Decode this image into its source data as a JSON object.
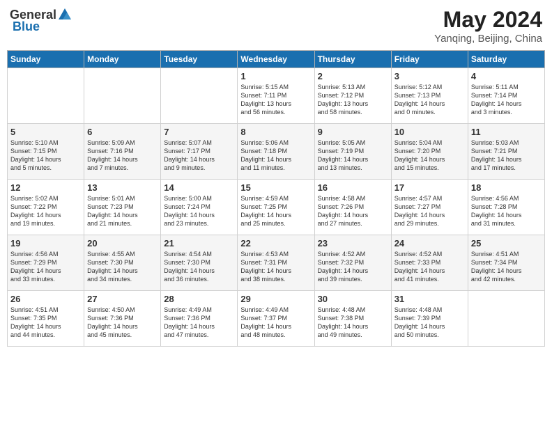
{
  "header": {
    "logo_general": "General",
    "logo_blue": "Blue",
    "month": "May 2024",
    "location": "Yanqing, Beijing, China"
  },
  "days_of_week": [
    "Sunday",
    "Monday",
    "Tuesday",
    "Wednesday",
    "Thursday",
    "Friday",
    "Saturday"
  ],
  "weeks": [
    {
      "days": [
        {
          "num": "",
          "info": ""
        },
        {
          "num": "",
          "info": ""
        },
        {
          "num": "",
          "info": ""
        },
        {
          "num": "1",
          "info": "Sunrise: 5:15 AM\nSunset: 7:11 PM\nDaylight: 13 hours\nand 56 minutes."
        },
        {
          "num": "2",
          "info": "Sunrise: 5:13 AM\nSunset: 7:12 PM\nDaylight: 13 hours\nand 58 minutes."
        },
        {
          "num": "3",
          "info": "Sunrise: 5:12 AM\nSunset: 7:13 PM\nDaylight: 14 hours\nand 0 minutes."
        },
        {
          "num": "4",
          "info": "Sunrise: 5:11 AM\nSunset: 7:14 PM\nDaylight: 14 hours\nand 3 minutes."
        }
      ]
    },
    {
      "days": [
        {
          "num": "5",
          "info": "Sunrise: 5:10 AM\nSunset: 7:15 PM\nDaylight: 14 hours\nand 5 minutes."
        },
        {
          "num": "6",
          "info": "Sunrise: 5:09 AM\nSunset: 7:16 PM\nDaylight: 14 hours\nand 7 minutes."
        },
        {
          "num": "7",
          "info": "Sunrise: 5:07 AM\nSunset: 7:17 PM\nDaylight: 14 hours\nand 9 minutes."
        },
        {
          "num": "8",
          "info": "Sunrise: 5:06 AM\nSunset: 7:18 PM\nDaylight: 14 hours\nand 11 minutes."
        },
        {
          "num": "9",
          "info": "Sunrise: 5:05 AM\nSunset: 7:19 PM\nDaylight: 14 hours\nand 13 minutes."
        },
        {
          "num": "10",
          "info": "Sunrise: 5:04 AM\nSunset: 7:20 PM\nDaylight: 14 hours\nand 15 minutes."
        },
        {
          "num": "11",
          "info": "Sunrise: 5:03 AM\nSunset: 7:21 PM\nDaylight: 14 hours\nand 17 minutes."
        }
      ]
    },
    {
      "days": [
        {
          "num": "12",
          "info": "Sunrise: 5:02 AM\nSunset: 7:22 PM\nDaylight: 14 hours\nand 19 minutes."
        },
        {
          "num": "13",
          "info": "Sunrise: 5:01 AM\nSunset: 7:23 PM\nDaylight: 14 hours\nand 21 minutes."
        },
        {
          "num": "14",
          "info": "Sunrise: 5:00 AM\nSunset: 7:24 PM\nDaylight: 14 hours\nand 23 minutes."
        },
        {
          "num": "15",
          "info": "Sunrise: 4:59 AM\nSunset: 7:25 PM\nDaylight: 14 hours\nand 25 minutes."
        },
        {
          "num": "16",
          "info": "Sunrise: 4:58 AM\nSunset: 7:26 PM\nDaylight: 14 hours\nand 27 minutes."
        },
        {
          "num": "17",
          "info": "Sunrise: 4:57 AM\nSunset: 7:27 PM\nDaylight: 14 hours\nand 29 minutes."
        },
        {
          "num": "18",
          "info": "Sunrise: 4:56 AM\nSunset: 7:28 PM\nDaylight: 14 hours\nand 31 minutes."
        }
      ]
    },
    {
      "days": [
        {
          "num": "19",
          "info": "Sunrise: 4:56 AM\nSunset: 7:29 PM\nDaylight: 14 hours\nand 33 minutes."
        },
        {
          "num": "20",
          "info": "Sunrise: 4:55 AM\nSunset: 7:30 PM\nDaylight: 14 hours\nand 34 minutes."
        },
        {
          "num": "21",
          "info": "Sunrise: 4:54 AM\nSunset: 7:30 PM\nDaylight: 14 hours\nand 36 minutes."
        },
        {
          "num": "22",
          "info": "Sunrise: 4:53 AM\nSunset: 7:31 PM\nDaylight: 14 hours\nand 38 minutes."
        },
        {
          "num": "23",
          "info": "Sunrise: 4:52 AM\nSunset: 7:32 PM\nDaylight: 14 hours\nand 39 minutes."
        },
        {
          "num": "24",
          "info": "Sunrise: 4:52 AM\nSunset: 7:33 PM\nDaylight: 14 hours\nand 41 minutes."
        },
        {
          "num": "25",
          "info": "Sunrise: 4:51 AM\nSunset: 7:34 PM\nDaylight: 14 hours\nand 42 minutes."
        }
      ]
    },
    {
      "days": [
        {
          "num": "26",
          "info": "Sunrise: 4:51 AM\nSunset: 7:35 PM\nDaylight: 14 hours\nand 44 minutes."
        },
        {
          "num": "27",
          "info": "Sunrise: 4:50 AM\nSunset: 7:36 PM\nDaylight: 14 hours\nand 45 minutes."
        },
        {
          "num": "28",
          "info": "Sunrise: 4:49 AM\nSunset: 7:36 PM\nDaylight: 14 hours\nand 47 minutes."
        },
        {
          "num": "29",
          "info": "Sunrise: 4:49 AM\nSunset: 7:37 PM\nDaylight: 14 hours\nand 48 minutes."
        },
        {
          "num": "30",
          "info": "Sunrise: 4:48 AM\nSunset: 7:38 PM\nDaylight: 14 hours\nand 49 minutes."
        },
        {
          "num": "31",
          "info": "Sunrise: 4:48 AM\nSunset: 7:39 PM\nDaylight: 14 hours\nand 50 minutes."
        },
        {
          "num": "",
          "info": ""
        }
      ]
    }
  ]
}
